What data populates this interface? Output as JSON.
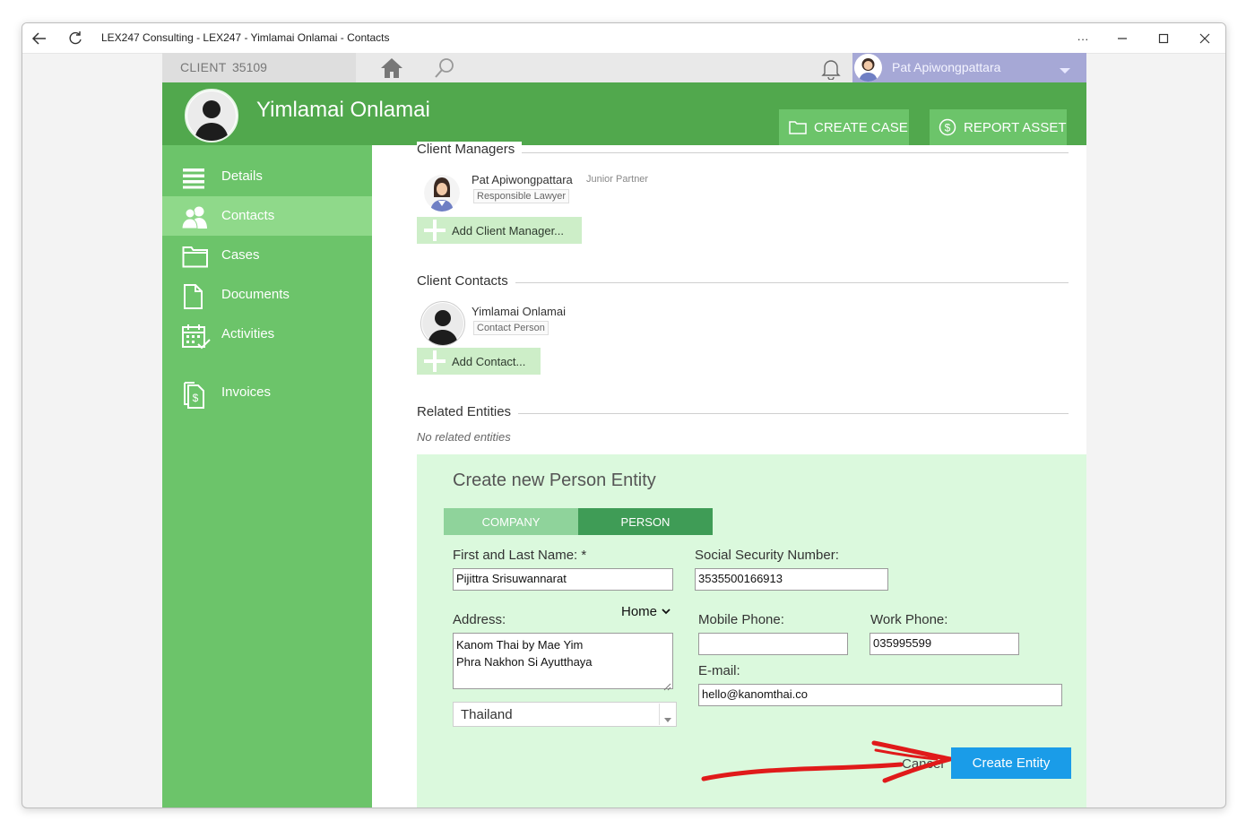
{
  "window": {
    "title": "LEX247 Consulting - LEX247 - Yimlamai Onlamai - Contacts",
    "more_label": "···"
  },
  "topbar": {
    "client_label": "CLIENT",
    "client_number": "35109",
    "user_name": "Pat Apiwongpattara"
  },
  "header": {
    "entity_name": "Yimlamai Onlamai",
    "create_case_label": "CREATE CASE",
    "report_asset_label": "REPORT ASSET"
  },
  "sidebar": {
    "items": [
      {
        "label": "Details",
        "icon": "list-icon"
      },
      {
        "label": "Contacts",
        "icon": "people-icon"
      },
      {
        "label": "Cases",
        "icon": "folder-icon"
      },
      {
        "label": "Documents",
        "icon": "document-icon"
      },
      {
        "label": "Activities",
        "icon": "calendar-icon"
      },
      {
        "label": "Invoices",
        "icon": "invoice-icon"
      }
    ],
    "active_index": 1
  },
  "client_managers": {
    "title": "Client Managers",
    "manager_name": "Pat Apiwongpattara",
    "manager_role": "Junior Partner",
    "manager_tag": "Responsible Lawyer",
    "add_label": "Add Client Manager..."
  },
  "client_contacts": {
    "title": "Client Contacts",
    "contact_name": "Yimlamai Onlamai",
    "contact_tag": "Contact Person",
    "add_label": "Add Contact..."
  },
  "related_entities": {
    "title": "Related Entities",
    "empty_text": "No related entities"
  },
  "form": {
    "title": "Create new Person Entity",
    "tabs": [
      "COMPANY",
      "PERSON"
    ],
    "selected_tab": "PERSON",
    "name_label": "First and Last Name: *",
    "name_value": "Pijittra Srisuwannarat",
    "ssn_label": "Social Security Number:",
    "ssn_value": "3535500166913",
    "address_label": "Address:",
    "address_type": "Home",
    "address_value": "Kanom Thai by Mae Yim\nPhra Nakhon Si Ayutthaya",
    "country_value": "Thailand",
    "mobile_label": "Mobile Phone:",
    "mobile_value": "",
    "work_label": "Work Phone:",
    "work_value": "035995599",
    "email_label": "E-mail:",
    "email_value": "hello@kanomthai.co",
    "cancel_label": "Cancel",
    "create_label": "Create Entity"
  },
  "colors": {
    "header_green": "#51a84d",
    "sidebar_green": "#6cc46a",
    "sidebar_active": "#8fd98a",
    "form_bg": "#dbf9dd",
    "segment_inactive": "#8fd39b",
    "segment_active": "#3f9c56",
    "primary_blue": "#1a9ce8",
    "annotation_red": "#e01a1a",
    "user_bar": "#a6a8d6"
  }
}
